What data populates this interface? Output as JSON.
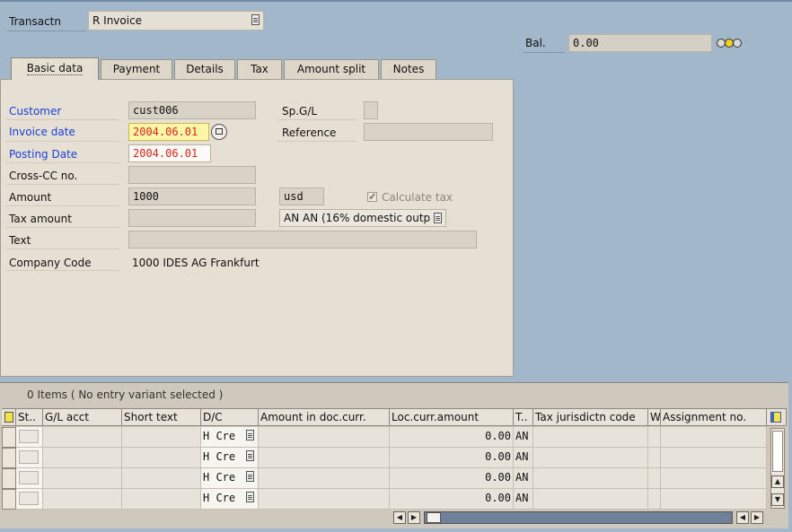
{
  "header": {
    "transaction_label": "Transactn",
    "transaction_value": "R Invoice",
    "balance_label": "Bal.",
    "balance_value": "0.00"
  },
  "tabs": [
    {
      "label": "Basic data",
      "active": true
    },
    {
      "label": "Payment",
      "active": false
    },
    {
      "label": "Details",
      "active": false
    },
    {
      "label": "Tax",
      "active": false
    },
    {
      "label": "Amount split",
      "active": false
    },
    {
      "label": "Notes",
      "active": false
    }
  ],
  "form": {
    "customer_label": "Customer",
    "customer_value": "cust006",
    "spgl_label": "Sp.G/L",
    "spgl_value": "",
    "invoice_date_label": "Invoice date",
    "invoice_date_value": "2004.06.01",
    "reference_label": "Reference",
    "reference_value": "",
    "posting_date_label": "Posting Date",
    "posting_date_value": "2004.06.01",
    "crosscc_label": "Cross-CC no.",
    "crosscc_value": "",
    "amount_label": "Amount",
    "amount_value": "1000",
    "currency_value": "usd",
    "calc_tax_label": "Calculate tax",
    "calc_tax_checked": true,
    "tax_amount_label": "Tax amount",
    "tax_amount_value": "",
    "tax_code_value": "AN AN (16% domestic outp",
    "text_label": "Text",
    "text_value": "",
    "company_code_label": "Company Code",
    "company_code_value": "1000 IDES AG Frankfurt"
  },
  "items_table": {
    "title": "0 Items ( No entry variant selected )",
    "columns": [
      "St..",
      "G/L acct",
      "Short text",
      "D/C",
      "Amount in doc.curr.",
      "Loc.curr.amount",
      "T..",
      "Tax jurisdictn code",
      "W",
      "Assignment no."
    ],
    "rows": [
      {
        "dc": "H Cre",
        "loc_amount": "0.00",
        "tax": "AN"
      },
      {
        "dc": "H Cre",
        "loc_amount": "0.00",
        "tax": "AN"
      },
      {
        "dc": "H Cre",
        "loc_amount": "0.00",
        "tax": "AN"
      },
      {
        "dc": "H Cre",
        "loc_amount": "0.00",
        "tax": "AN"
      }
    ]
  },
  "colors": {
    "background": "#a3b7ca",
    "panel": "#e6dfd3",
    "required_label": "#1a3fd6",
    "date_text": "#d8251b",
    "focus_field": "#fff6a8",
    "status_yellow": "#f3d21b"
  },
  "icons": [
    "dropdown-icon",
    "calendar-icon",
    "status-lights-icon",
    "table-settings-icon",
    "select-all-icon",
    "scroll-arrow-icon"
  ]
}
